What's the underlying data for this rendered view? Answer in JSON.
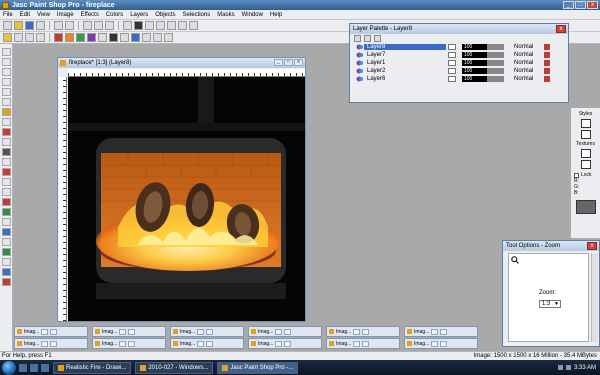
{
  "app": {
    "title": "Jasc Paint Shop Pro - fireplace"
  },
  "window_buttons": {
    "minimize": "_",
    "maximize": "□",
    "close": "x"
  },
  "menu": [
    "File",
    "Edit",
    "View",
    "Image",
    "Effects",
    "Colors",
    "Layers",
    "Objects",
    "Selections",
    "Masks",
    "Window",
    "Help"
  ],
  "document": {
    "title": "fireplace* [1:3] (Layer8)"
  },
  "layer_palette": {
    "title": "Layer Palette - Layer8",
    "layers": [
      {
        "name": "Layer8",
        "opacity": "100",
        "blend": "Normal",
        "selected": true
      },
      {
        "name": "Layer7",
        "opacity": "100",
        "blend": "Normal",
        "selected": false
      },
      {
        "name": "Layer1",
        "opacity": "100",
        "blend": "Normal",
        "selected": false
      },
      {
        "name": "Layer2",
        "opacity": "100",
        "blend": "Normal",
        "selected": false
      },
      {
        "name": "Layer6",
        "opacity": "100",
        "blend": "Normal",
        "selected": false
      }
    ]
  },
  "styles_panel": {
    "styles_label": "Styles",
    "textures_label": "Textures",
    "lock_label": "Lock",
    "r_label": "R:",
    "g_label": "G:",
    "b_label": "B:"
  },
  "tool_options": {
    "title": "Tool Options - Zoom",
    "zoom_label": "Zoom:",
    "zoom_value": "1:3"
  },
  "minimized_windows": [
    "Imag...",
    "Imag...",
    "Imag...",
    "Imag...",
    "Imag...",
    "Imag...",
    "Imag...",
    "Imag...",
    "Imag...",
    "Imag...",
    "Imag...",
    "Imag..."
  ],
  "status": {
    "left": "For Help, press F1",
    "right": "Image: 1500 x 1500 x 16 Million - 35.4 MBytes"
  },
  "taskbar": {
    "items": [
      "Realistic Fire - Drawi...",
      "2010-027 - Windows...",
      "Jasc Paint Shop Pro -..."
    ],
    "clock": "3:33 AM"
  }
}
